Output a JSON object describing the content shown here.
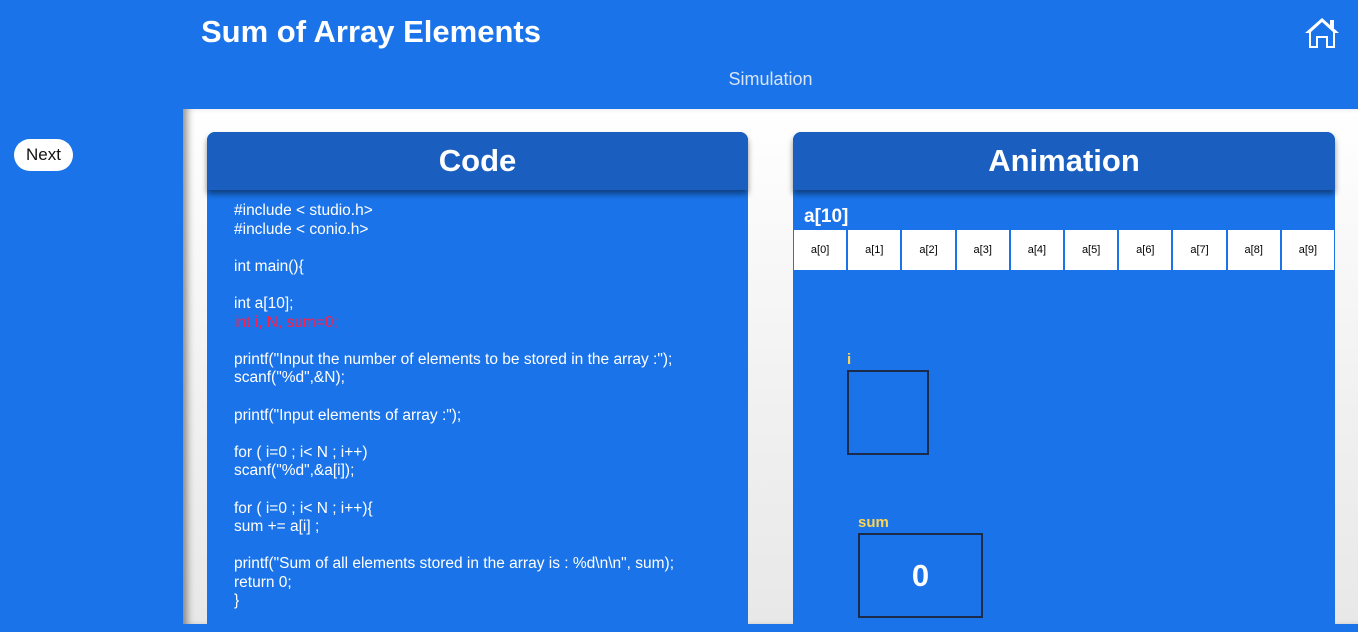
{
  "header": {
    "title": "Sum of Array Elements",
    "subtitle": "Simulation"
  },
  "sidebar": {
    "next_label": "Next"
  },
  "code_panel": {
    "title": "Code",
    "lines": [
      "#include < studio.h>",
      "#include < conio.h>",
      "",
      "int main(){",
      "",
      "int a[10];",
      "int i, N, sum=0;",
      "",
      "printf(\"Input the number of elements to be stored in the array :\");",
      "scanf(\"%d\",&N);",
      "",
      "printf(\"Input elements of array :\");",
      "",
      "for ( i=0 ; i< N ; i++)",
      "scanf(\"%d\",&a[i]);",
      "",
      "for ( i=0 ; i< N ; i++){",
      "sum += a[i] ;",
      "",
      "printf(\"Sum of all elements stored in the array is : %d\\n\\n\", sum);",
      "return 0;",
      "}"
    ],
    "highlight_line": 6,
    "highlight_color": "#ff1f4b"
  },
  "animation_panel": {
    "title": "Animation",
    "array_label": "a[10]",
    "cells": [
      "a[0]",
      "a[1]",
      "a[2]",
      "a[3]",
      "a[4]",
      "a[5]",
      "a[6]",
      "a[7]",
      "a[8]",
      "a[9]"
    ],
    "variables": {
      "i": {
        "label": "i",
        "value": ""
      },
      "sum": {
        "label": "sum",
        "value": "0"
      }
    }
  },
  "icons": {
    "home": "home-icon"
  },
  "colors": {
    "accent": "#1a73e8",
    "panel_header": "#1a5fc0",
    "variable_label": "#ffd54f"
  }
}
